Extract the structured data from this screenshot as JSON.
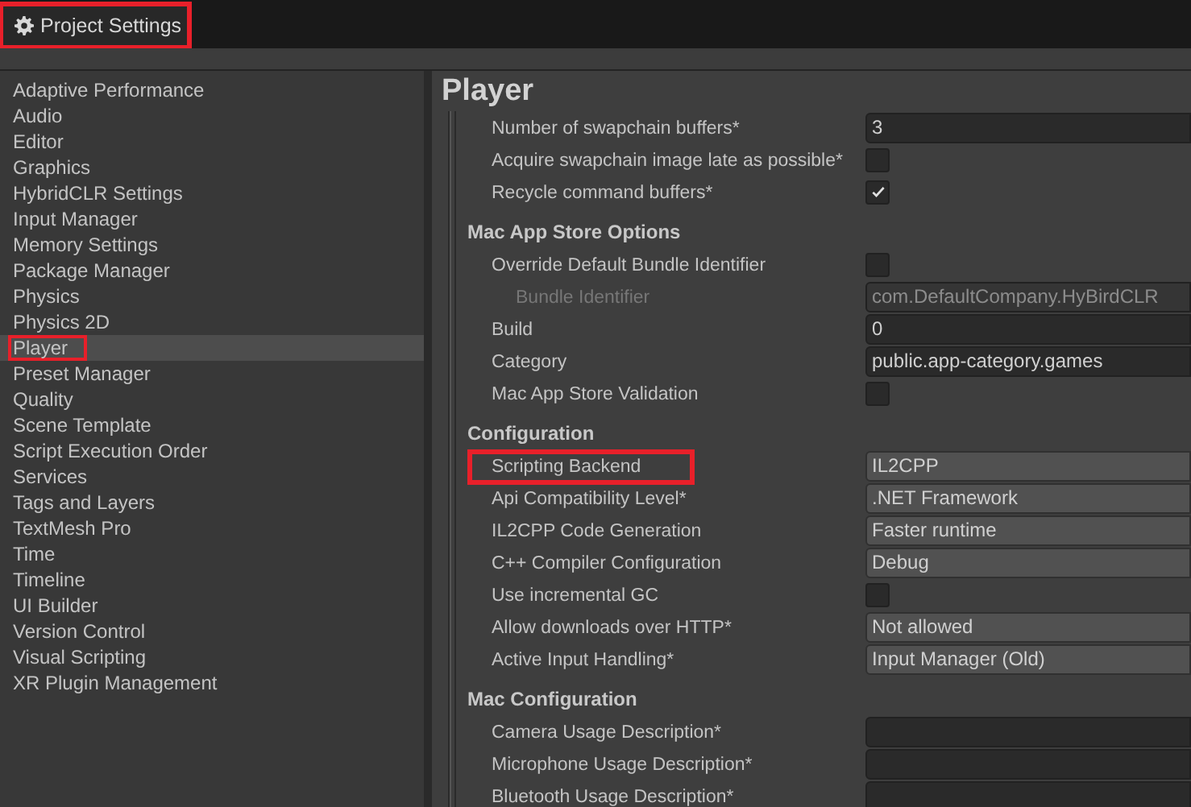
{
  "window": {
    "title": "Project Settings",
    "highlighted": true
  },
  "sidebar": {
    "items": [
      {
        "label": "Adaptive Performance",
        "selected": false,
        "highlighted": false
      },
      {
        "label": "Audio",
        "selected": false,
        "highlighted": false
      },
      {
        "label": "Editor",
        "selected": false,
        "highlighted": false
      },
      {
        "label": "Graphics",
        "selected": false,
        "highlighted": false
      },
      {
        "label": "HybridCLR Settings",
        "selected": false,
        "highlighted": false
      },
      {
        "label": "Input Manager",
        "selected": false,
        "highlighted": false
      },
      {
        "label": "Memory Settings",
        "selected": false,
        "highlighted": false
      },
      {
        "label": "Package Manager",
        "selected": false,
        "highlighted": false
      },
      {
        "label": "Physics",
        "selected": false,
        "highlighted": false
      },
      {
        "label": "Physics 2D",
        "selected": false,
        "highlighted": false
      },
      {
        "label": "Player",
        "selected": true,
        "highlighted": true
      },
      {
        "label": "Preset Manager",
        "selected": false,
        "highlighted": false
      },
      {
        "label": "Quality",
        "selected": false,
        "highlighted": false
      },
      {
        "label": "Scene Template",
        "selected": false,
        "highlighted": false
      },
      {
        "label": "Script Execution Order",
        "selected": false,
        "highlighted": false
      },
      {
        "label": "Services",
        "selected": false,
        "highlighted": false
      },
      {
        "label": "Tags and Layers",
        "selected": false,
        "highlighted": false
      },
      {
        "label": "TextMesh Pro",
        "selected": false,
        "highlighted": false
      },
      {
        "label": "Time",
        "selected": false,
        "highlighted": false
      },
      {
        "label": "Timeline",
        "selected": false,
        "highlighted": false
      },
      {
        "label": "UI Builder",
        "selected": false,
        "highlighted": false
      },
      {
        "label": "Version Control",
        "selected": false,
        "highlighted": false
      },
      {
        "label": "Visual Scripting",
        "selected": false,
        "highlighted": false
      },
      {
        "label": "XR Plugin Management",
        "selected": false,
        "highlighted": false
      }
    ]
  },
  "panel": {
    "title": "Player",
    "sections": [
      {
        "rows": [
          {
            "kind": "text",
            "label": "Number of swapchain buffers*",
            "value": "3",
            "disabled": false,
            "highlighted": false
          },
          {
            "kind": "checkbox",
            "label": "Acquire swapchain image late as possible*",
            "checked": false,
            "disabled": false,
            "highlighted": false
          },
          {
            "kind": "checkbox",
            "label": "Recycle command buffers*",
            "checked": true,
            "disabled": false,
            "highlighted": false
          }
        ]
      },
      {
        "header": "Mac App Store Options",
        "rows": [
          {
            "kind": "checkbox",
            "label": "Override Default Bundle Identifier",
            "checked": false,
            "disabled": false,
            "highlighted": false
          },
          {
            "kind": "text",
            "label": "Bundle Identifier",
            "value": "com.DefaultCompany.HyBirdCLR",
            "disabled": true,
            "indented": true,
            "highlighted": false
          },
          {
            "kind": "text",
            "label": "Build",
            "value": "0",
            "disabled": false,
            "highlighted": false
          },
          {
            "kind": "text",
            "label": "Category",
            "value": "public.app-category.games",
            "disabled": false,
            "highlighted": false
          },
          {
            "kind": "checkbox",
            "label": "Mac App Store Validation",
            "checked": false,
            "disabled": false,
            "highlighted": false
          }
        ]
      },
      {
        "header": "Configuration",
        "rows": [
          {
            "kind": "dropdown",
            "label": "Scripting Backend",
            "value": "IL2CPP",
            "disabled": false,
            "highlighted": true
          },
          {
            "kind": "dropdown",
            "label": "Api Compatibility Level*",
            "value": ".NET Framework",
            "disabled": false,
            "highlighted": false
          },
          {
            "kind": "dropdown",
            "label": "IL2CPP Code Generation",
            "value": "Faster runtime",
            "disabled": false,
            "highlighted": false
          },
          {
            "kind": "dropdown",
            "label": "C++ Compiler Configuration",
            "value": "Debug",
            "disabled": false,
            "highlighted": false
          },
          {
            "kind": "checkbox",
            "label": "Use incremental GC",
            "checked": false,
            "disabled": false,
            "highlighted": false
          },
          {
            "kind": "dropdown",
            "label": "Allow downloads over HTTP*",
            "value": "Not allowed",
            "disabled": false,
            "highlighted": false
          },
          {
            "kind": "dropdown",
            "label": "Active Input Handling*",
            "value": "Input Manager (Old)",
            "disabled": false,
            "highlighted": false
          }
        ]
      },
      {
        "header": "Mac Configuration",
        "rows": [
          {
            "kind": "text",
            "label": "Camera Usage Description*",
            "disabled": false,
            "highlighted": false
          },
          {
            "kind": "text",
            "label": "Microphone Usage Description*",
            "disabled": false,
            "highlighted": false
          },
          {
            "kind": "text",
            "label": "Bluetooth Usage Description*",
            "disabled": false,
            "highlighted": false
          }
        ]
      }
    ]
  }
}
